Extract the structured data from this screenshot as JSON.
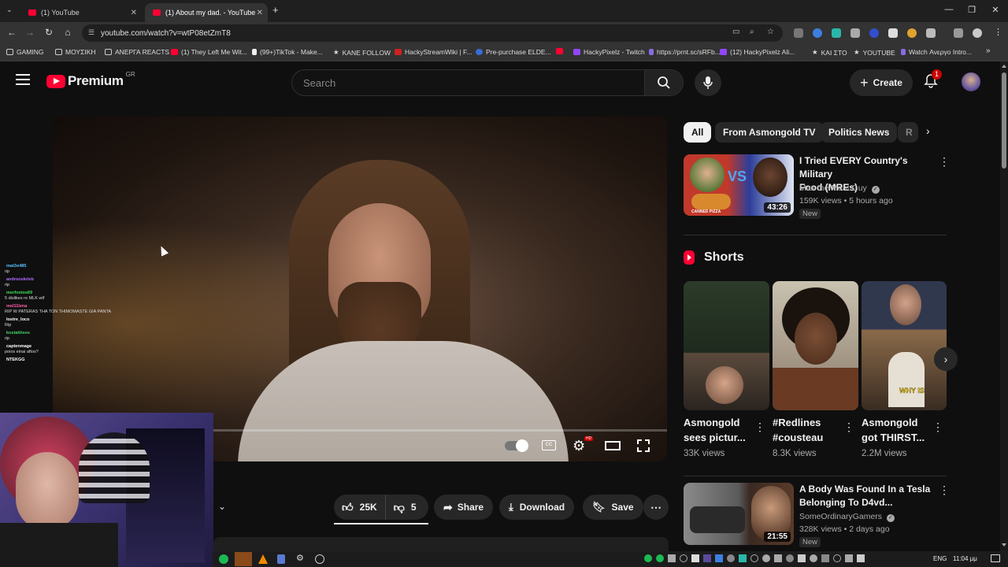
{
  "browser": {
    "tabs": [
      {
        "label": "(1) YouTube",
        "active": false
      },
      {
        "label": "(1) About my dad. - YouTube",
        "active": true
      }
    ],
    "new_tab": "+",
    "url": "youtube.com/watch?v=wtP08etZmT8",
    "bookmarks": [
      {
        "label": "GAMING",
        "icon": "folder-icon"
      },
      {
        "label": "ΜΟΥΣΙΚΗ",
        "icon": "folder-icon"
      },
      {
        "label": "ΑΝΕΡΓΑ REACTS",
        "icon": "folder-icon"
      },
      {
        "label": "(1) They Left Me Wit...",
        "icon": "youtube-icon"
      },
      {
        "label": "(99+)TikTok - Make...",
        "icon": "tiktok-icon"
      },
      {
        "label": "KANE FOLLOW",
        "icon": "star-icon"
      },
      {
        "label": "HackyStreamWiki | F...",
        "icon": "wiki-icon"
      },
      {
        "label": "Pre-purchase ELDE...",
        "icon": "steam-icon"
      },
      {
        "label": "",
        "icon": "youtube-icon"
      },
      {
        "label": "HackyPixelz - Twitch",
        "icon": "twitch-icon"
      },
      {
        "label": "https://prnt.sc/sRFb...",
        "icon": "feather-icon"
      },
      {
        "label": "(12) HackyPixelz Ali...",
        "icon": "twitch-icon"
      },
      {
        "label": "ΚΑΙ ΣΤΟ",
        "icon": "star-icon"
      },
      {
        "label": "YOUTUBE",
        "icon": "star-icon"
      },
      {
        "label": "Watch Ανεργο Intro...",
        "icon": "feather-icon"
      }
    ],
    "more_bookmarks": "»"
  },
  "youtube": {
    "logo_text": "Premium",
    "region": "GR",
    "search_placeholder": "Search",
    "create_label": "Create",
    "notification_count": "1"
  },
  "actions": {
    "likes": "25K",
    "dislikes": "5",
    "share": "Share",
    "download": "Download",
    "save": "Save"
  },
  "chips": [
    "All",
    "From Asmongold TV",
    "Politics News",
    "R"
  ],
  "recommendations": [
    {
      "title_line1": "I Tried EVERY Country's Military",
      "title_line2": "Food (MREs)",
      "channel": "Max the Meat Guy",
      "meta": "159K views • 5 hours ago",
      "badge": "New",
      "duration": "43:26",
      "thumb_vs": "VS",
      "thumb_caption": "CANNED PIZZA"
    },
    {
      "title_line1": "A Body Was Found In a Tesla",
      "title_line2": "Belonging To D4vd...",
      "channel": "SomeOrdinaryGamers",
      "meta": "328K views • 2 days ago",
      "badge": "New",
      "duration": "21:55"
    }
  ],
  "shorts_header": "Shorts",
  "shorts": [
    {
      "title_line1": "Asmongold",
      "title_line2": "sees pictur...",
      "views": "33K views"
    },
    {
      "title_line1": "#Redlines",
      "title_line2": "#cousteau",
      "views": "8.3K views"
    },
    {
      "title_line1": "Asmongold",
      "title_line2": "got THIRST...",
      "views": "2.2M views",
      "thumb_caption": "WHY IS"
    }
  ],
  "chat": [
    {
      "user": "mat3o485",
      "color": "#5bc2ff",
      "msg": "rip"
    },
    {
      "user": "androoskrieb",
      "color": "#b36bff",
      "msg": "rip"
    },
    {
      "user": "morfonios69",
      "color": "#3fe05a",
      "msg": "5 dislikes re MLK wtf"
    },
    {
      "user": "mel11lena",
      "color": "#ff5fa8",
      "msg": "RIP W PATERAS THA TON THIMOMASTE GIA PANTA"
    },
    {
      "user": "lostre_loco",
      "color": "#ffffff",
      "msg": "Rip"
    },
    {
      "user": "kostakhses",
      "color": "#43d16b",
      "msg": "rip"
    },
    {
      "user": "captenmage",
      "color": "#ffffff",
      "msg": "poios einai aftos?"
    },
    {
      "user": "NTEKGG",
      "color": "#ffffff",
      "msg": ""
    }
  ],
  "player": {
    "hd_badge": "HD"
  },
  "taskbar": {
    "language": "ENG",
    "time": "11:04 μμ"
  }
}
